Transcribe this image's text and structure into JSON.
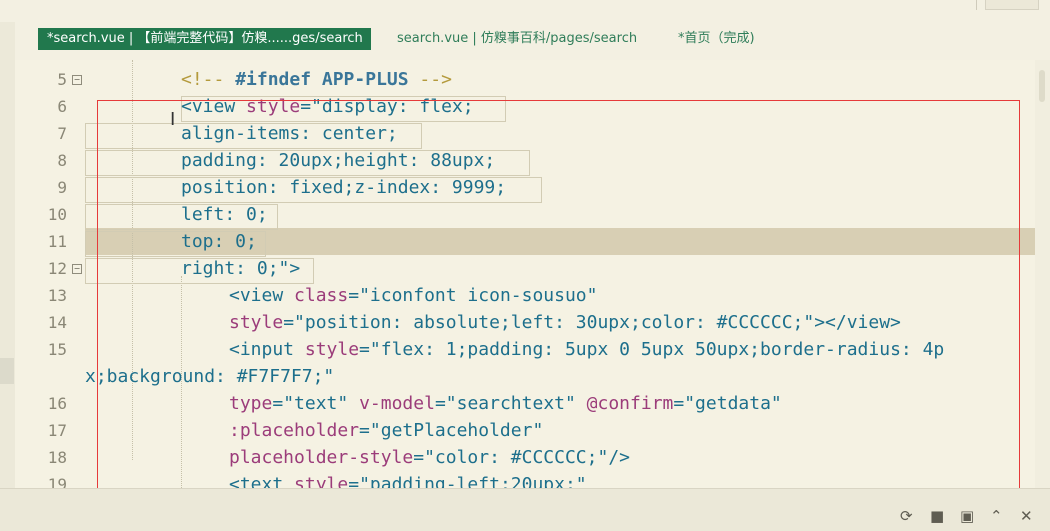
{
  "tabs": [
    {
      "label": "*search.vue | 【前端完整代码】仿糗......ges/search",
      "active": true
    },
    {
      "label": "search.vue | 仿糗事百科/pages/search",
      "active": false
    },
    {
      "label": "*首页（完成)",
      "active": false
    }
  ],
  "line_numbers": [
    "5",
    "6",
    "7",
    "8",
    "9",
    "10",
    "11",
    "12",
    "13",
    "14",
    "15",
    "16",
    "17",
    "18",
    "19"
  ],
  "code": {
    "l5": {
      "comment": "<!-- ",
      "directive": "#ifndef APP-PLUS",
      "end": " -->"
    },
    "l6": {
      "tag": "<view ",
      "attr": "style",
      "eq": "=",
      "value": "\"display: flex;"
    },
    "l7": "align-items: center;",
    "l8": "padding: 20upx;height: 88upx;",
    "l9": "position: fixed;z-index: 9999;",
    "l10": "left: 0;",
    "l11": "top: 0;",
    "l12": "right: 0;\">",
    "l13": {
      "tag": "<view ",
      "attr": "class",
      "eq": "=",
      "value": "\"iconfont icon-sousuo\""
    },
    "l14": {
      "attr": "style",
      "eq": "=",
      "value": "\"position: absolute;left: 30upx;color: #CCCCCC;\"",
      "end": "></view>"
    },
    "l15": {
      "tag": "<input ",
      "attr": "style",
      "eq": "=",
      "value": "\"flex: 1;padding: 5upx 0 5upx 50upx;border-radius: 4p"
    },
    "l15b": "x;background: #F7F7F7;\"",
    "l16": {
      "attr1": "type",
      "value1": "\"text\"",
      "attr2": "v-model",
      "value2": "\"searchtext\"",
      "attr3": "@confirm",
      "value3": "\"getdata\""
    },
    "l17": {
      "attr": ":placeholder",
      "value": "\"getPlaceholder\""
    },
    "l18": {
      "attr": "placeholder-style",
      "value": "\"color: #CCCCCC;\"",
      "end": "/>"
    },
    "l19": {
      "tag": "<text ",
      "attr": "style",
      "value": "\"padding-left:20upx;\""
    }
  },
  "bottom_icons": [
    "run-icon",
    "stop-icon",
    "console-icon",
    "collapse-up-icon",
    "close-icon"
  ],
  "colors": {
    "accent_tab": "#21784d",
    "highlight_line": "#d8cfb4",
    "red_box": "#e63a3a",
    "background": "#f5f2e3"
  }
}
